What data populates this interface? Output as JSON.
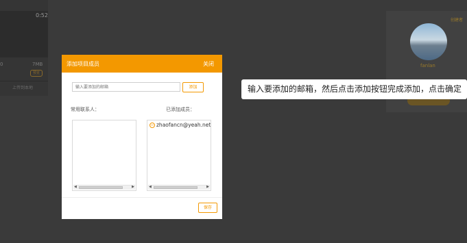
{
  "background": {
    "video_time": "0:52",
    "count": "0",
    "file_size": "7MB",
    "badge": "预览",
    "upload_label": "上传到本地",
    "create_label": "创建者",
    "username": "fanlan"
  },
  "modal": {
    "title": "添加项目成员",
    "close_label": "关闭",
    "email_placeholder": "输入要添加的邮箱",
    "add_button": "添加",
    "contacts_label": "常用联系人：",
    "added_label": "已添加成员：",
    "added_members": [
      "zhaofancn@yeah.net"
    ],
    "save_button": "保存"
  },
  "tooltip": {
    "text": "输入要添加的邮箱，然后点击添加按钮完成添加，点击确定"
  },
  "colors": {
    "accent": "#f39800",
    "overlay": "#3a3a3a"
  }
}
